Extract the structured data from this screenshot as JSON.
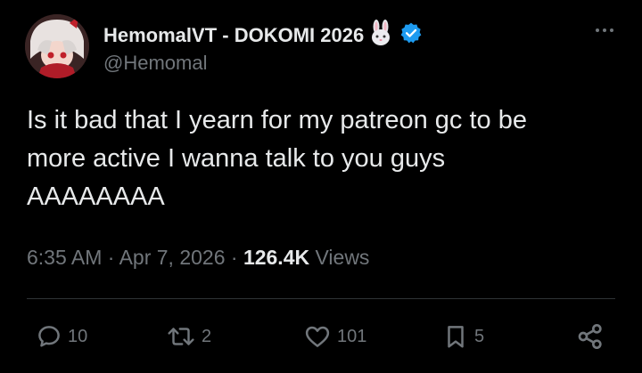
{
  "user": {
    "display_name": "HemomalVT - DOKOMI 2026",
    "handle": "@Hemomal",
    "emoji_icon": "rabbit-emoji",
    "verified_icon": "verified-badge-icon",
    "verified_color": "#1d9bf0"
  },
  "tweet": {
    "text": "Is it bad that I yearn for my patreon gc to be\nmore active I wanna talk to you guys\nAAAAAAAA",
    "time": "6:35 AM",
    "date": "Apr 7, 2026",
    "views_count": "126.4K",
    "views_label": "Views"
  },
  "actions": {
    "reply": {
      "icon": "reply-icon",
      "count": "10"
    },
    "retweet": {
      "icon": "retweet-icon",
      "count": "2"
    },
    "like": {
      "icon": "heart-icon",
      "count": "101"
    },
    "bookmark": {
      "icon": "bookmark-icon",
      "count": "5"
    },
    "share": {
      "icon": "share-icon"
    }
  },
  "colors": {
    "background": "#000000",
    "primary_text": "#e7e9ea",
    "secondary_text": "#71767b",
    "divider": "#2f3336"
  }
}
